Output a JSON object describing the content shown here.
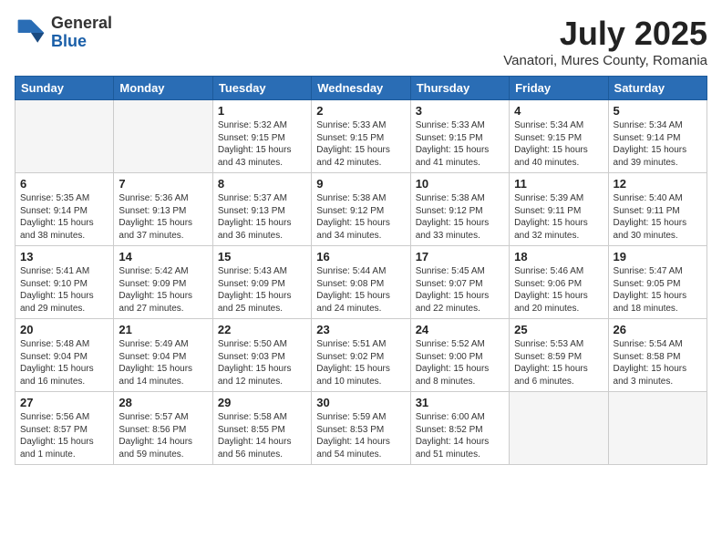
{
  "header": {
    "logo_general": "General",
    "logo_blue": "Blue",
    "month_year": "July 2025",
    "location": "Vanatori, Mures County, Romania"
  },
  "weekdays": [
    "Sunday",
    "Monday",
    "Tuesday",
    "Wednesday",
    "Thursday",
    "Friday",
    "Saturday"
  ],
  "weeks": [
    [
      {
        "day": "",
        "empty": true
      },
      {
        "day": "",
        "empty": true
      },
      {
        "day": "1",
        "sunrise": "Sunrise: 5:32 AM",
        "sunset": "Sunset: 9:15 PM",
        "daylight": "Daylight: 15 hours and 43 minutes."
      },
      {
        "day": "2",
        "sunrise": "Sunrise: 5:33 AM",
        "sunset": "Sunset: 9:15 PM",
        "daylight": "Daylight: 15 hours and 42 minutes."
      },
      {
        "day": "3",
        "sunrise": "Sunrise: 5:33 AM",
        "sunset": "Sunset: 9:15 PM",
        "daylight": "Daylight: 15 hours and 41 minutes."
      },
      {
        "day": "4",
        "sunrise": "Sunrise: 5:34 AM",
        "sunset": "Sunset: 9:15 PM",
        "daylight": "Daylight: 15 hours and 40 minutes."
      },
      {
        "day": "5",
        "sunrise": "Sunrise: 5:34 AM",
        "sunset": "Sunset: 9:14 PM",
        "daylight": "Daylight: 15 hours and 39 minutes."
      }
    ],
    [
      {
        "day": "6",
        "sunrise": "Sunrise: 5:35 AM",
        "sunset": "Sunset: 9:14 PM",
        "daylight": "Daylight: 15 hours and 38 minutes."
      },
      {
        "day": "7",
        "sunrise": "Sunrise: 5:36 AM",
        "sunset": "Sunset: 9:13 PM",
        "daylight": "Daylight: 15 hours and 37 minutes."
      },
      {
        "day": "8",
        "sunrise": "Sunrise: 5:37 AM",
        "sunset": "Sunset: 9:13 PM",
        "daylight": "Daylight: 15 hours and 36 minutes."
      },
      {
        "day": "9",
        "sunrise": "Sunrise: 5:38 AM",
        "sunset": "Sunset: 9:12 PM",
        "daylight": "Daylight: 15 hours and 34 minutes."
      },
      {
        "day": "10",
        "sunrise": "Sunrise: 5:38 AM",
        "sunset": "Sunset: 9:12 PM",
        "daylight": "Daylight: 15 hours and 33 minutes."
      },
      {
        "day": "11",
        "sunrise": "Sunrise: 5:39 AM",
        "sunset": "Sunset: 9:11 PM",
        "daylight": "Daylight: 15 hours and 32 minutes."
      },
      {
        "day": "12",
        "sunrise": "Sunrise: 5:40 AM",
        "sunset": "Sunset: 9:11 PM",
        "daylight": "Daylight: 15 hours and 30 minutes."
      }
    ],
    [
      {
        "day": "13",
        "sunrise": "Sunrise: 5:41 AM",
        "sunset": "Sunset: 9:10 PM",
        "daylight": "Daylight: 15 hours and 29 minutes."
      },
      {
        "day": "14",
        "sunrise": "Sunrise: 5:42 AM",
        "sunset": "Sunset: 9:09 PM",
        "daylight": "Daylight: 15 hours and 27 minutes."
      },
      {
        "day": "15",
        "sunrise": "Sunrise: 5:43 AM",
        "sunset": "Sunset: 9:09 PM",
        "daylight": "Daylight: 15 hours and 25 minutes."
      },
      {
        "day": "16",
        "sunrise": "Sunrise: 5:44 AM",
        "sunset": "Sunset: 9:08 PM",
        "daylight": "Daylight: 15 hours and 24 minutes."
      },
      {
        "day": "17",
        "sunrise": "Sunrise: 5:45 AM",
        "sunset": "Sunset: 9:07 PM",
        "daylight": "Daylight: 15 hours and 22 minutes."
      },
      {
        "day": "18",
        "sunrise": "Sunrise: 5:46 AM",
        "sunset": "Sunset: 9:06 PM",
        "daylight": "Daylight: 15 hours and 20 minutes."
      },
      {
        "day": "19",
        "sunrise": "Sunrise: 5:47 AM",
        "sunset": "Sunset: 9:05 PM",
        "daylight": "Daylight: 15 hours and 18 minutes."
      }
    ],
    [
      {
        "day": "20",
        "sunrise": "Sunrise: 5:48 AM",
        "sunset": "Sunset: 9:04 PM",
        "daylight": "Daylight: 15 hours and 16 minutes."
      },
      {
        "day": "21",
        "sunrise": "Sunrise: 5:49 AM",
        "sunset": "Sunset: 9:04 PM",
        "daylight": "Daylight: 15 hours and 14 minutes."
      },
      {
        "day": "22",
        "sunrise": "Sunrise: 5:50 AM",
        "sunset": "Sunset: 9:03 PM",
        "daylight": "Daylight: 15 hours and 12 minutes."
      },
      {
        "day": "23",
        "sunrise": "Sunrise: 5:51 AM",
        "sunset": "Sunset: 9:02 PM",
        "daylight": "Daylight: 15 hours and 10 minutes."
      },
      {
        "day": "24",
        "sunrise": "Sunrise: 5:52 AM",
        "sunset": "Sunset: 9:00 PM",
        "daylight": "Daylight: 15 hours and 8 minutes."
      },
      {
        "day": "25",
        "sunrise": "Sunrise: 5:53 AM",
        "sunset": "Sunset: 8:59 PM",
        "daylight": "Daylight: 15 hours and 6 minutes."
      },
      {
        "day": "26",
        "sunrise": "Sunrise: 5:54 AM",
        "sunset": "Sunset: 8:58 PM",
        "daylight": "Daylight: 15 hours and 3 minutes."
      }
    ],
    [
      {
        "day": "27",
        "sunrise": "Sunrise: 5:56 AM",
        "sunset": "Sunset: 8:57 PM",
        "daylight": "Daylight: 15 hours and 1 minute."
      },
      {
        "day": "28",
        "sunrise": "Sunrise: 5:57 AM",
        "sunset": "Sunset: 8:56 PM",
        "daylight": "Daylight: 14 hours and 59 minutes."
      },
      {
        "day": "29",
        "sunrise": "Sunrise: 5:58 AM",
        "sunset": "Sunset: 8:55 PM",
        "daylight": "Daylight: 14 hours and 56 minutes."
      },
      {
        "day": "30",
        "sunrise": "Sunrise: 5:59 AM",
        "sunset": "Sunset: 8:53 PM",
        "daylight": "Daylight: 14 hours and 54 minutes."
      },
      {
        "day": "31",
        "sunrise": "Sunrise: 6:00 AM",
        "sunset": "Sunset: 8:52 PM",
        "daylight": "Daylight: 14 hours and 51 minutes."
      },
      {
        "day": "",
        "empty": true
      },
      {
        "day": "",
        "empty": true
      }
    ]
  ]
}
